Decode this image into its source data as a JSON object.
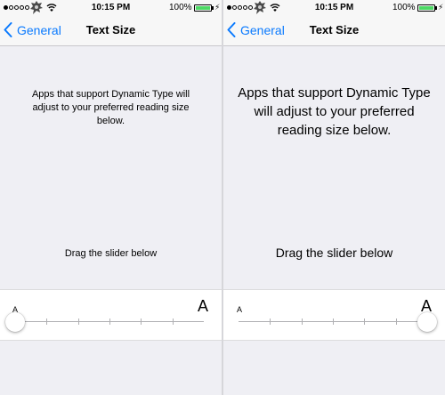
{
  "status_bar": {
    "time": "10:15 PM",
    "battery": "100%",
    "signal_dots": 5,
    "signal_filled": 1
  },
  "nav": {
    "back_label": "General",
    "title": "Text Size"
  },
  "left": {
    "description": "Apps that support Dynamic Type will adjust to your preferred reading size below.",
    "drag_hint": "Drag the slider below",
    "slider": {
      "min_label": "A",
      "max_label": "A",
      "position": 0
    }
  },
  "right": {
    "description": "Apps that support Dynamic Type will adjust to your preferred reading size below.",
    "drag_hint": "Drag the slider below",
    "slider": {
      "min_label": "A",
      "max_label": "A",
      "position": 1
    }
  },
  "slider_steps": 7,
  "colors": {
    "accent": "#0a7afe",
    "background": "#efeff4",
    "battery": "#4cd964"
  },
  "icons": {
    "back": "chevron-left-icon",
    "wifi": "wifi-icon",
    "carrier": "carrier-logo-icon",
    "charging": "bolt-icon"
  }
}
